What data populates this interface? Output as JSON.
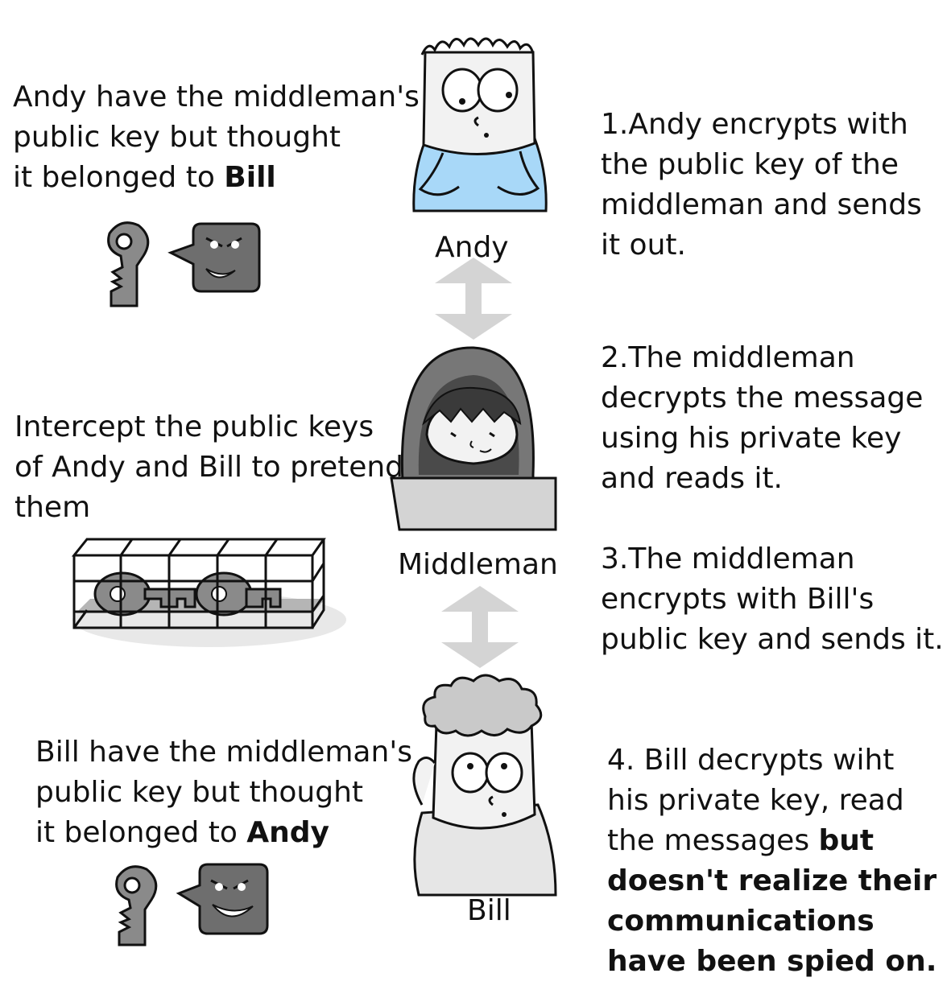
{
  "characters": {
    "andy": "Andy",
    "middleman": "Middleman",
    "bill": "Bill"
  },
  "left_notes": {
    "andy": {
      "line1": "Andy have the middleman's",
      "line2": "public key but thought",
      "line3_prefix": "it belonged to ",
      "line3_bold": "Bill"
    },
    "middleman": {
      "line1": "Intercept the public keys",
      "line2": "of Andy and Bill to pretend",
      "line3": "them"
    },
    "bill": {
      "line1": "Bill have the middleman's",
      "line2": "public key but thought",
      "line3_prefix": "it belonged to ",
      "line3_bold": "Andy"
    }
  },
  "steps": {
    "step1": [
      "1.Andy encrypts with",
      "the public key of the",
      "middleman and sends",
      "it out."
    ],
    "step2": [
      "2.The middleman",
      "decrypts the message",
      "using his private key",
      "and reads it."
    ],
    "step3": [
      "3.The middleman",
      "encrypts with Bill's",
      "public key and sends it."
    ],
    "step4": {
      "lines": [
        "4. Bill decrypts wiht",
        "his private key, read"
      ],
      "line3_prefix": "the messages ",
      "line3_bold": "but",
      "bold_lines": [
        "doesn't realize their",
        "communications",
        "have been spied on."
      ]
    }
  },
  "colors": {
    "andy_shirt": "#a8d8f8",
    "hood": "#777777",
    "hood_dark": "#4a4a4a",
    "laptop": "#d4d4d4",
    "key": "#8a8a8a",
    "bubble": "#6e6e6e",
    "arrow": "#d4d4d4",
    "bill_shirt": "#e6e6e6",
    "shadow": "#e8e8e8"
  }
}
